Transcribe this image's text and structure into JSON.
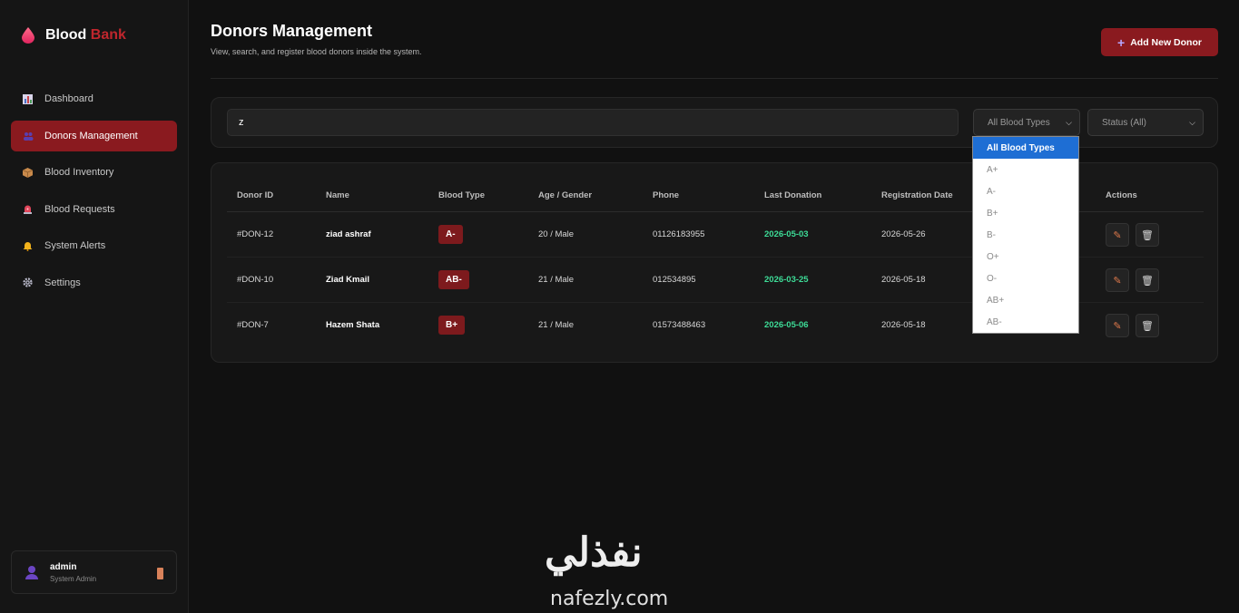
{
  "brand": {
    "name_part1": "Blood",
    "name_part2": "Bank",
    "accent_color": "#c0262d"
  },
  "sidebar": {
    "items": [
      {
        "label": "Dashboard",
        "icon": "chart-icon",
        "active": false
      },
      {
        "label": "Donors Management",
        "icon": "people-icon",
        "active": true
      },
      {
        "label": "Blood Inventory",
        "icon": "box-icon",
        "active": false
      },
      {
        "label": "Blood Requests",
        "icon": "siren-icon",
        "active": false
      },
      {
        "label": "System Alerts",
        "icon": "bell-icon",
        "active": false
      },
      {
        "label": "Settings",
        "icon": "gear-icon",
        "active": false
      }
    ],
    "user": {
      "name": "admin",
      "role": "System Admin"
    }
  },
  "header": {
    "title": "Donors Management",
    "subtitle": "View, search, and register blood donors inside the system.",
    "add_button": "Add New Donor"
  },
  "filters": {
    "search_value": "z",
    "blood_type_selected": "All Blood Types",
    "status_selected": "Status (All)",
    "blood_type_options": [
      "All Blood Types",
      "A+",
      "A-",
      "B+",
      "B-",
      "O+",
      "O-",
      "AB+",
      "AB-"
    ]
  },
  "table": {
    "headers": [
      "Donor ID",
      "Name",
      "Blood Type",
      "Age / Gender",
      "Phone",
      "Last Donation",
      "Registration Date",
      "Actions"
    ],
    "rows": [
      {
        "id": "#DON-12",
        "name": "ziad ashraf",
        "blood_type": "A-",
        "age_gender": "20 / Male",
        "phone": "01126183955",
        "last_donation": "2026-05-03",
        "registration": "2026-05-26"
      },
      {
        "id": "#DON-10",
        "name": "Ziad Kmail",
        "blood_type": "AB-",
        "age_gender": "21 / Male",
        "phone": "012534895",
        "last_donation": "2026-03-25",
        "registration": "2026-05-18"
      },
      {
        "id": "#DON-7",
        "name": "Hazem Shata",
        "blood_type": "B+",
        "age_gender": "21 / Male",
        "phone": "01573488463",
        "last_donation": "2026-05-06",
        "registration": "2026-05-18"
      }
    ]
  },
  "watermark": {
    "arabic": "نفذلي",
    "latin": "nafezly.com"
  }
}
